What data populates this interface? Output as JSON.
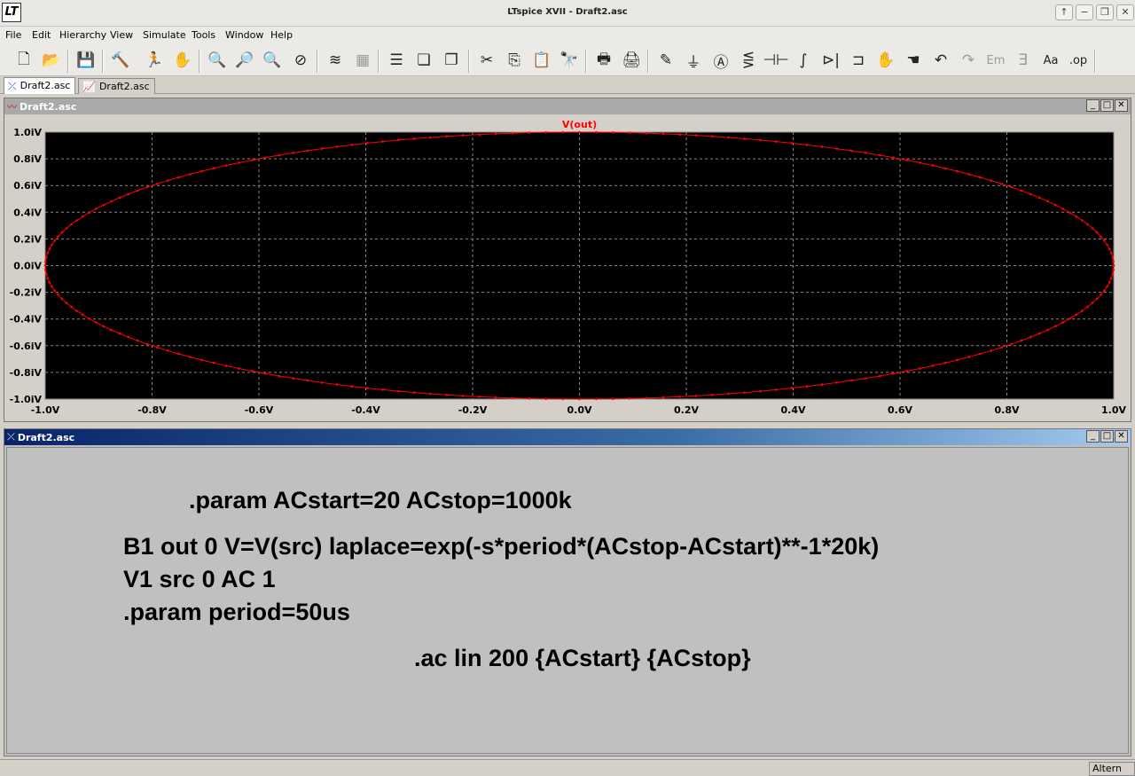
{
  "app": {
    "title": "LTspice XVII - Draft2.asc",
    "logo_text": "LT",
    "window_buttons": [
      "↑",
      "−",
      "❐",
      "✕"
    ]
  },
  "menu": [
    {
      "label": "File",
      "key": "F"
    },
    {
      "label": "Edit",
      "key": "E"
    },
    {
      "label": "Hierarchy",
      "key": "i"
    },
    {
      "label": "View",
      "key": "V"
    },
    {
      "label": "Simulate",
      "key": "S"
    },
    {
      "label": "Tools",
      "key": "T"
    },
    {
      "label": "Window",
      "key": "W"
    },
    {
      "label": "Help",
      "key": "H"
    }
  ],
  "toolbar": [
    {
      "name": "new-schematic-icon",
      "glyph": "🗋"
    },
    {
      "name": "open-icon",
      "glyph": "📂"
    },
    {
      "name": "save-icon",
      "glyph": "💾"
    },
    {
      "name": "control-panel-icon",
      "glyph": "🔨"
    },
    {
      "name": "run-icon",
      "glyph": "🏃"
    },
    {
      "name": "halt-icon",
      "glyph": "✋",
      "disabled": true
    },
    {
      "name": "zoom-in-icon",
      "glyph": "🔍"
    },
    {
      "name": "zoom-pan-icon",
      "glyph": "🔎",
      "disabled": true
    },
    {
      "name": "zoom-out-icon",
      "glyph": "🔍"
    },
    {
      "name": "zoom-fit-icon",
      "glyph": "⊘"
    },
    {
      "name": "autorange-icon",
      "glyph": "≋"
    },
    {
      "name": "plot-settings-icon",
      "glyph": "▦",
      "disabled": true
    },
    {
      "name": "tile-horizontal-icon",
      "glyph": "☰"
    },
    {
      "name": "cascade-icon",
      "glyph": "❏"
    },
    {
      "name": "tile-vertical-icon",
      "glyph": "❐"
    },
    {
      "name": "cut-icon",
      "glyph": "✂"
    },
    {
      "name": "copy-icon",
      "glyph": "⎘"
    },
    {
      "name": "paste-icon",
      "glyph": "📋"
    },
    {
      "name": "find-icon",
      "glyph": "🔭"
    },
    {
      "name": "print-preview-icon",
      "glyph": "🖶"
    },
    {
      "name": "print-icon",
      "glyph": "🖨"
    },
    {
      "name": "wire-icon",
      "glyph": "✎"
    },
    {
      "name": "ground-icon",
      "glyph": "⏚"
    },
    {
      "name": "label-net-icon",
      "glyph": "Ⓐ"
    },
    {
      "name": "resistor-icon",
      "glyph": "⋚"
    },
    {
      "name": "capacitor-icon",
      "glyph": "⊣⊢"
    },
    {
      "name": "inductor-icon",
      "glyph": "∫"
    },
    {
      "name": "diode-icon",
      "glyph": "⊳|"
    },
    {
      "name": "component-icon",
      "glyph": "⊐"
    },
    {
      "name": "move-icon",
      "glyph": "✋"
    },
    {
      "name": "drag-icon",
      "glyph": "☚"
    },
    {
      "name": "undo-icon",
      "glyph": "↶"
    },
    {
      "name": "redo-icon",
      "glyph": "↷",
      "disabled": true
    },
    {
      "name": "rotate-icon",
      "glyph": "Em",
      "disabled": true
    },
    {
      "name": "mirror-icon",
      "glyph": "Ǝ",
      "disabled": true
    },
    {
      "name": "text-icon",
      "glyph": "Aa"
    },
    {
      "name": "spice-directive-icon",
      "glyph": ".op"
    }
  ],
  "tabs": [
    {
      "label": "Draft2.asc",
      "icon": "schematic-tab-icon",
      "glyph": "⤫",
      "active": true
    },
    {
      "label": "Draft2.asc",
      "icon": "waveform-tab-icon",
      "glyph": "📈",
      "active": false
    }
  ],
  "plot_window": {
    "title": "Draft2.asc",
    "buttons": [
      "_",
      "□",
      "✕"
    ],
    "trace_color": "#ff0000",
    "background": "#000000"
  },
  "chart_data": {
    "type": "scatter",
    "title": "V(out)",
    "series": [
      {
        "name": "V(out)",
        "shape": "ellipse",
        "center": [
          0,
          0
        ],
        "rx": 1.0,
        "ry": 1.0,
        "points": 200
      }
    ],
    "xlim": [
      -1.0,
      1.0
    ],
    "ylim": [
      -1.0,
      1.0
    ],
    "xticks": [
      "-1.0V",
      "-0.8V",
      "-0.6V",
      "-0.4V",
      "-0.2V",
      "0.0V",
      "0.2V",
      "0.4V",
      "0.6V",
      "0.8V",
      "1.0V"
    ],
    "yticks": [
      "1.0iV",
      "0.8iV",
      "0.6iV",
      "0.4iV",
      "0.2iV",
      "0.0iV",
      "-0.2iV",
      "-0.4iV",
      "-0.6iV",
      "-0.8iV",
      "-1.0iV"
    ],
    "grid": true
  },
  "schematic_window": {
    "title": "Draft2.asc",
    "buttons": [
      "_",
      "□",
      "✕"
    ],
    "directives": [
      ".param ACstart=20 ACstop=1000k",
      "B1 out 0 V=V(src) laplace=exp(-s*period*(ACstop-ACstart)**-1*20k)",
      "V1 src 0 AC 1",
      ".param period=50us",
      ".ac lin 200 {ACstart} {ACstop}"
    ]
  },
  "status": {
    "text": "Altern"
  }
}
